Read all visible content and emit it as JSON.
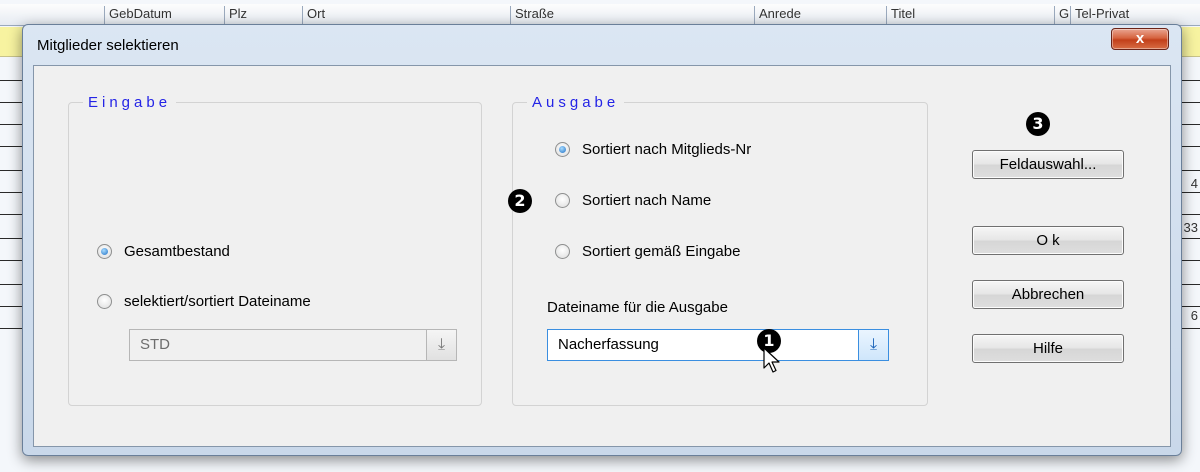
{
  "background_table": {
    "headers": [
      "GebDatum",
      "Plz",
      "Ort",
      "Straße",
      "Anrede",
      "Titel",
      "G",
      "Tel-Privat"
    ],
    "right_values": [
      "4",
      "33",
      "6"
    ]
  },
  "dialog": {
    "title": "Mitglieder selektieren",
    "close_label": "x"
  },
  "eingabe": {
    "title": "Eingabe",
    "options": [
      {
        "label": "Gesamtbestand",
        "checked": true
      },
      {
        "label": "selektiert/sortiert Dateiname",
        "checked": false
      }
    ],
    "file_value": "STD",
    "dropdown_icon": "download-arrow-icon"
  },
  "ausgabe": {
    "title": "Ausgabe",
    "options": [
      {
        "label": "Sortiert nach Mitglieds-Nr",
        "checked": true
      },
      {
        "label": "Sortiert nach Name",
        "checked": false
      },
      {
        "label": "Sortiert gemäß Eingabe",
        "checked": false
      }
    ],
    "file_label": "Dateiname für die Ausgabe",
    "file_value": "Nacherfassung",
    "dropdown_icon": "download-arrow-icon"
  },
  "buttons": {
    "feldauswahl": "Feldauswahl...",
    "ok": "O k",
    "abbrechen": "Abbrechen",
    "hilfe": "Hilfe"
  },
  "annotations": [
    "1",
    "2",
    "3"
  ],
  "colors": {
    "group_title": "#2424e6",
    "dialog_frame": "#c9d8ea",
    "close_button": "#c23f1a",
    "highlight_row": "#f7f3a0"
  }
}
